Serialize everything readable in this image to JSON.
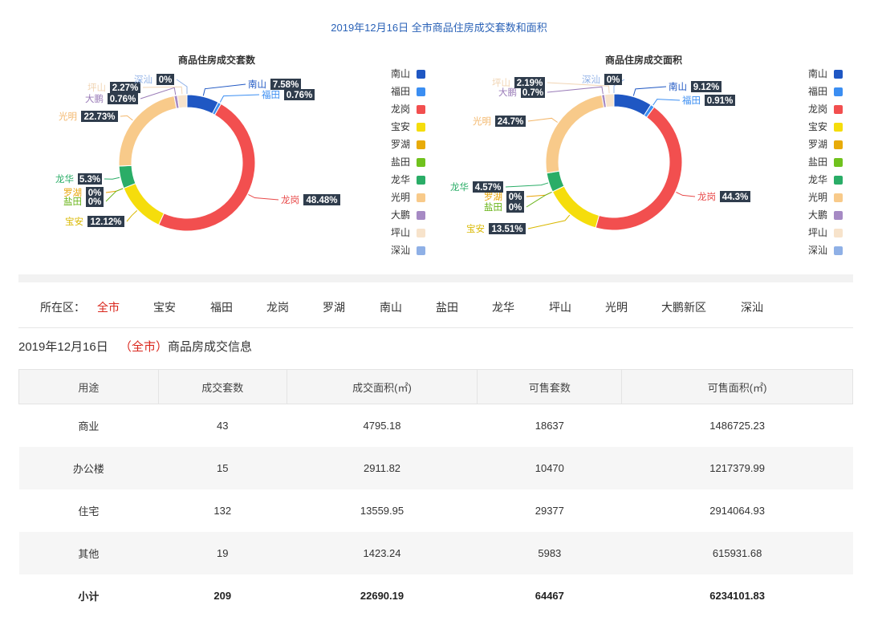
{
  "header": {
    "title": "2019年12月16日 全市商品住房成交套数和面积"
  },
  "legend": {
    "items": [
      {
        "name": "南山",
        "color": "#1f57c3"
      },
      {
        "name": "福田",
        "color": "#3b8ef2"
      },
      {
        "name": "龙岗",
        "color": "#f24f4f"
      },
      {
        "name": "宝安",
        "color": "#f5dd0c"
      },
      {
        "name": "罗湖",
        "color": "#e8ab08"
      },
      {
        "name": "盐田",
        "color": "#70c21e"
      },
      {
        "name": "龙华",
        "color": "#2aad67"
      },
      {
        "name": "光明",
        "color": "#f8ca8a"
      },
      {
        "name": "大鹏",
        "color": "#a68ac4"
      },
      {
        "name": "坪山",
        "color": "#f7e3cb"
      },
      {
        "name": "深汕",
        "color": "#8fb0e6"
      }
    ]
  },
  "chart_data": [
    {
      "type": "pie",
      "title": "商品住房成交套数",
      "unit": "%",
      "categories": [
        "南山",
        "福田",
        "龙岗",
        "宝安",
        "罗湖",
        "盐田",
        "龙华",
        "光明",
        "大鹏",
        "坪山",
        "深汕"
      ],
      "values": [
        7.58,
        0.76,
        48.48,
        12.12,
        0,
        0,
        5.3,
        22.73,
        0.76,
        2.27,
        0
      ],
      "labels": [
        "7.58%",
        "0.76%",
        "48.48%",
        "12.12%",
        "0%",
        "0%",
        "5.3%",
        "22.73%",
        "0.76%",
        "2.27%",
        "0%"
      ]
    },
    {
      "type": "pie",
      "title": "商品住房成交面积",
      "unit": "%",
      "categories": [
        "南山",
        "福田",
        "龙岗",
        "宝安",
        "罗湖",
        "盐田",
        "龙华",
        "光明",
        "大鹏",
        "坪山",
        "深汕"
      ],
      "values": [
        9.12,
        0.91,
        44.3,
        13.51,
        0,
        0,
        4.57,
        24.7,
        0.7,
        2.19,
        0
      ],
      "labels": [
        "9.12%",
        "0.91%",
        "44.3%",
        "13.51%",
        "0%",
        "0%",
        "4.57%",
        "24.7%",
        "0.7%",
        "2.19%",
        "0%"
      ]
    }
  ],
  "district_filter": {
    "label": "所在区：",
    "items": [
      "全市",
      "宝安",
      "福田",
      "龙岗",
      "罗湖",
      "南山",
      "盐田",
      "龙华",
      "坪山",
      "光明",
      "大鹏新区",
      "深汕"
    ],
    "active": "全市"
  },
  "info": {
    "date": "2019年12月16日",
    "open": "（",
    "scope": "全市",
    "close": "）",
    "suffix": "商品房成交信息"
  },
  "table": {
    "headers": [
      "用途",
      "成交套数",
      "成交面积(㎡)",
      "可售套数",
      "可售面积(㎡)"
    ],
    "rows": [
      [
        "商业",
        "43",
        "4795.18",
        "18637",
        "1486725.23"
      ],
      [
        "办公楼",
        "15",
        "2911.82",
        "10470",
        "1217379.99"
      ],
      [
        "住宅",
        "132",
        "13559.95",
        "29377",
        "2914064.93"
      ],
      [
        "其他",
        "19",
        "1423.24",
        "5983",
        "615931.68"
      ]
    ],
    "total": [
      "小计",
      "209",
      "22690.19",
      "64467",
      "6234101.83"
    ]
  }
}
